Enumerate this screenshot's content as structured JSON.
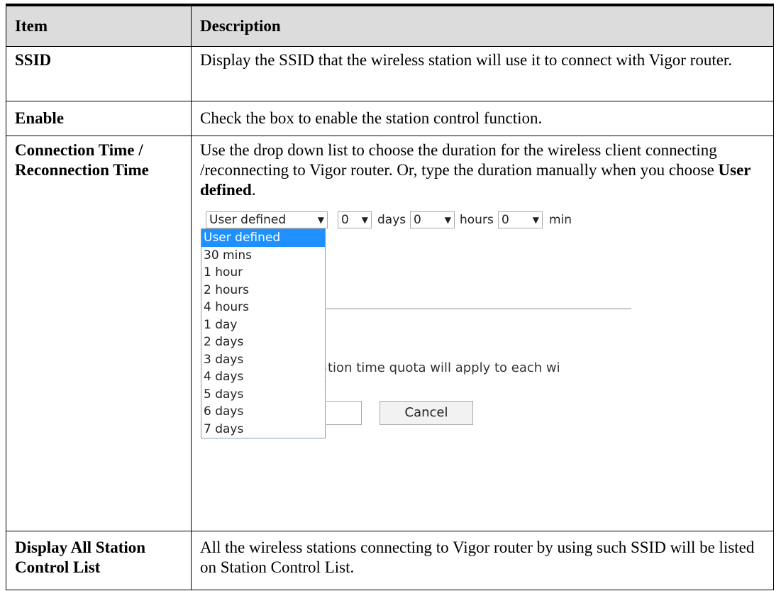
{
  "header": {
    "item": "Item",
    "description": "Description"
  },
  "rows": [
    {
      "item": "SSID",
      "description": "Display the SSID that the wireless station will use it to connect with Vigor router."
    },
    {
      "item": "Enable",
      "description": "Check the box to enable the station control function."
    },
    {
      "item_line1": "Connection Time /",
      "item_line2": "Reconnection Time",
      "description_pre": "Use the drop down list to choose the duration for the wireless client connecting /reconnecting to Vigor router. Or, type the duration manually when you choose ",
      "description_bold": "User defined",
      "description_post": "."
    },
    {
      "item_line1": "Display All Station",
      "item_line2": "Control List",
      "description": "All the wireless stations connecting to Vigor router by using such SSID will be listed on Station Control List."
    }
  ],
  "ui": {
    "duration_select": "User defined",
    "days_value": "0",
    "days_label": "days",
    "hours_value": "0",
    "hours_label": "hours",
    "min_value": "0",
    "min_label": "min",
    "options": [
      "User defined",
      "30 mins",
      "1 hour",
      "2 hours",
      "4 hours",
      "1 day",
      "2 days",
      "3 days",
      "4 days",
      "5 days",
      "6 days",
      "7 days"
    ],
    "partial_text": "tion time quota will apply to each wi",
    "cancel_label": "Cancel",
    "arrow_glyph": "▼"
  }
}
